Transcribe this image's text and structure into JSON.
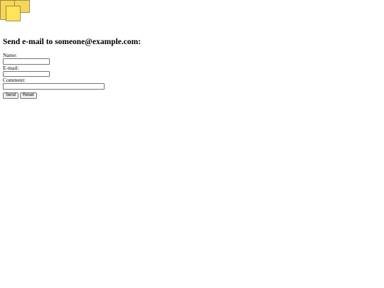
{
  "logo": {
    "icon": "overlapping-squares-logo",
    "colors": {
      "back_square": "#f5d65a",
      "front_square": "#ffe35a",
      "outline": "#8a7a30"
    }
  },
  "heading": "Send e-mail to someone@example.com:",
  "form": {
    "name_label": "Name:",
    "name_value": "",
    "email_label": "E-mail:",
    "email_value": "",
    "comment_label": "Comment:",
    "comment_value": ""
  },
  "buttons": {
    "send_label": "Send",
    "reset_label": "Reset"
  }
}
